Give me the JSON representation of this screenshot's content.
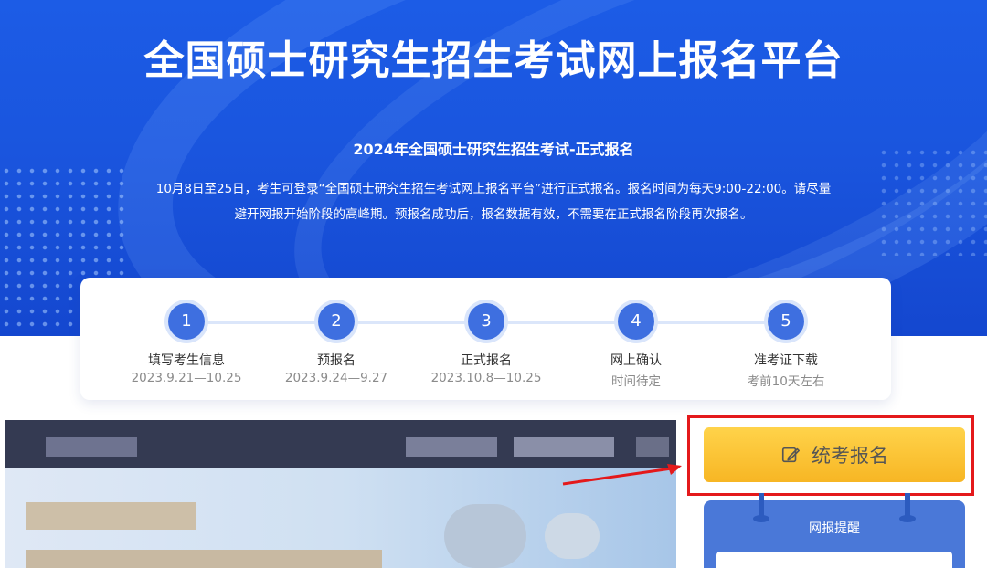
{
  "hero": {
    "title": "全国硕士研究生招生考试网上报名平台",
    "subtitle": "2024年全国硕士研究生招生考试-正式报名",
    "desc_line1": "10月8日至25日，考生可登录“全国硕士研究生招生考试网上报名平台”进行正式报名。报名时间为每天9:00-22:00。请尽量",
    "desc_line2": "避开网报开始阶段的高峰期。预报名成功后，报名数据有效，不需要在正式报名阶段再次报名。"
  },
  "steps": [
    {
      "num": "1",
      "name": "填写考生信息",
      "date": "2023.9.21—10.25"
    },
    {
      "num": "2",
      "name": "预报名",
      "date": "2023.9.24—9.27"
    },
    {
      "num": "3",
      "name": "正式报名",
      "date": "2023.10.8—10.25"
    },
    {
      "num": "4",
      "name": "网上确认",
      "date": "时间待定"
    },
    {
      "num": "5",
      "name": "准考证下载",
      "date": "考前10天左右"
    }
  ],
  "actions": {
    "exam_signup_label": "统考报名",
    "exam_signup_icon": "edit-icon"
  },
  "reminder": {
    "title": "网报提醒"
  },
  "colors": {
    "hero_blue": "#1a55de",
    "step_blue": "#3e6fe0",
    "button_yellow": "#f7b624",
    "highlight_red": "#e4191b",
    "reminder_blue": "#4a78d8"
  }
}
